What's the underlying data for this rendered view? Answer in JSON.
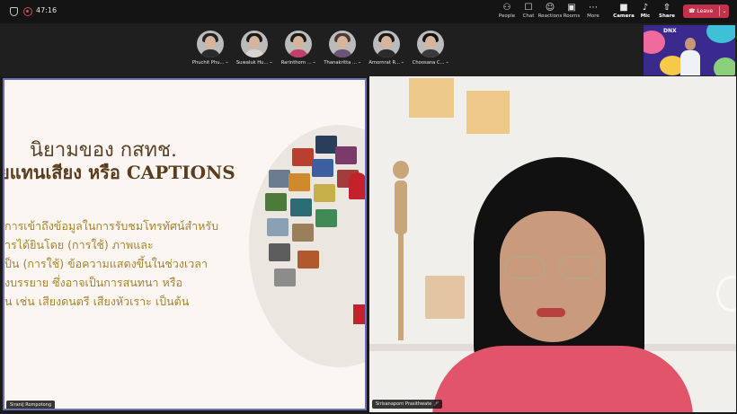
{
  "header": {
    "timer": "47:16",
    "toolbar": [
      {
        "label": "People",
        "icon": "people-icon",
        "glyph": "⚇"
      },
      {
        "label": "Chat",
        "icon": "chat-icon",
        "glyph": "☐"
      },
      {
        "label": "Reactions",
        "icon": "reactions-icon",
        "glyph": "☺"
      },
      {
        "label": "Rooms",
        "icon": "rooms-icon",
        "glyph": "▣"
      },
      {
        "label": "More",
        "icon": "more-icon",
        "glyph": "⋯"
      },
      {
        "label": "Camera",
        "icon": "camera-icon",
        "glyph": "■"
      },
      {
        "label": "Mic",
        "icon": "mic-off-icon",
        "glyph": "♪"
      },
      {
        "label": "Share",
        "icon": "share-icon",
        "glyph": "⇧"
      }
    ],
    "leave_label": "Leave",
    "leave_color": "#c4314b"
  },
  "participants": [
    {
      "name": "Phuchit Phu...",
      "hair": "#222",
      "body": "#2b2b2b"
    },
    {
      "name": "Suwaluk Hu...",
      "hair": "#1a1a1a",
      "body": "#d9d4cf"
    },
    {
      "name": "Rarinthorn ...",
      "hair": "#1a1a1a",
      "body": "#c13f6a"
    },
    {
      "name": "Thanakritta ...",
      "hair": "#4a3a33",
      "body": "#6a5478"
    },
    {
      "name": "Amornrat R...",
      "hair": "#1a1a1a",
      "body": "#2a2a2a"
    },
    {
      "name": "Choosana C...",
      "hair": "#111",
      "body": "#3a3a3a"
    }
  ],
  "selfview": {
    "banner": "DNX"
  },
  "slide": {
    "title_line1": "นิยามของ กสทช.",
    "title_line2": "ยแทนเสียง หรือ CAPTIONS",
    "body_lines": [
      "การเข้าถึงข้อมูลในการรับชมโทรทัศน์สำหรับ",
      "ารได้ยินโดย (การใช้) ภาพและ",
      "ป็น (การใช้) ข้อความแสดงขึ้นในช่วงเวลา",
      "งบรรยาย ซึ่งอาจเป็นการสนทนา หรือ",
      "น เช่น เสียงดนตรี เสียงหัวเราะ เป็นต้น"
    ],
    "presenter_name": "Siranij Rompotong"
  },
  "camera": {
    "name": "Sirisanaporn Prasithwate"
  }
}
